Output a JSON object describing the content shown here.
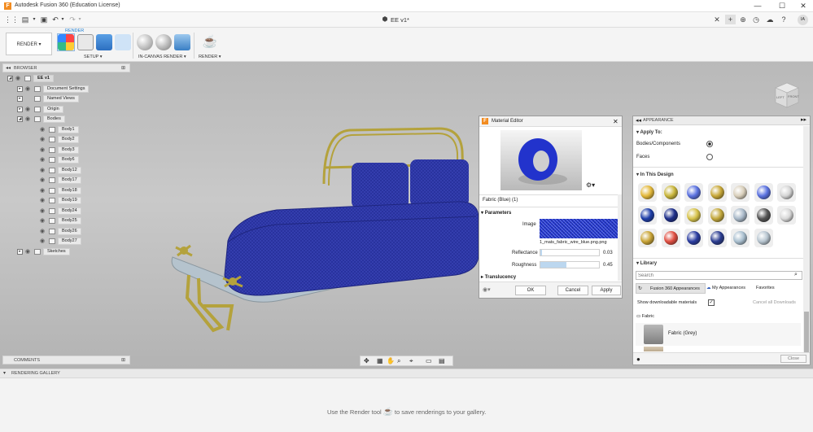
{
  "window": {
    "title": "Autodesk Fusion 360 (Education License)",
    "controls": [
      "—",
      "☐",
      "✕"
    ]
  },
  "tabs": {
    "document_title": "EE v1*",
    "user_initials": "IA"
  },
  "toolbar": {
    "workspace": "RENDER",
    "tab_label": "RENDER",
    "groups": {
      "setup": "SETUP",
      "in_canvas_render": "IN-CANVAS RENDER",
      "render": "RENDER"
    }
  },
  "browser": {
    "title": "BROWSER",
    "root": "EE v1",
    "items": [
      "Document Settings",
      "Named Views",
      "Origin",
      "Bodies"
    ],
    "bodies": [
      "Body1",
      "Body2",
      "Body3",
      "Body6",
      "Body12",
      "Body17",
      "Body18",
      "Body19",
      "Body24",
      "Body25",
      "Body26",
      "Body27"
    ],
    "sketches": "Sketches"
  },
  "comments": {
    "title": "COMMENTS"
  },
  "viewcube": {
    "top": "TOP",
    "front": "FRONT",
    "left": "LEFT"
  },
  "gallery": {
    "title": "RENDERING GALLERY",
    "hint_before": "Use the Render tool",
    "hint_after": "to save renderings to your gallery."
  },
  "material_editor": {
    "title": "Material Editor",
    "material_name": "Fabric (Blue) (1)",
    "section_parameters": "Parameters",
    "image_label": "Image",
    "image_file": "1_mats_fabric_wire_blue.png.png",
    "reflectance_label": "Reflectance",
    "reflectance_value": "0.03",
    "reflectance_level": 0.03,
    "roughness_label": "Roughness",
    "roughness_value": "0.45",
    "roughness_level": 0.45,
    "section_translucency": "Translucency",
    "ok": "OK",
    "cancel": "Cancel",
    "apply": "Apply"
  },
  "appearance": {
    "title": "APPEARANCE",
    "apply_to": "Apply To:",
    "opt_bodies": "Bodies/Components",
    "opt_faces": "Faces",
    "in_this_design": "In This Design",
    "swatches": [
      "#e3b83a",
      "#c9b63c",
      "#5b72e0",
      "#c8a838",
      "#d9cfbb",
      "#5b72e0",
      "#d5d5d5",
      "#1e3ea8",
      "#1e2f8a",
      "#d6c24a",
      "#c3a83c",
      "#a8b8c8",
      "#555555",
      "#d8d8d8",
      "#c9a436",
      "#e04f42",
      "#2a3ca0",
      "#2a3c90",
      "#a9bfcf",
      "#b7c5d0"
    ],
    "library": "Library",
    "search_placeholder": "Search",
    "lib_tabs": [
      "Fusion 360 Appearances",
      "My Appearances",
      "Favorites"
    ],
    "show_downloadable": "Show downloadable materials",
    "cancel_all": "Cancel all Downloads",
    "category": "Fabric",
    "list_items": [
      "Fabric (Grey)"
    ],
    "close": "Close"
  },
  "colors": {
    "accent": "#1f7fd4",
    "fabric_blue": "#27309c",
    "frame_gold": "#b4a23c",
    "base": "#b5c3cd"
  }
}
